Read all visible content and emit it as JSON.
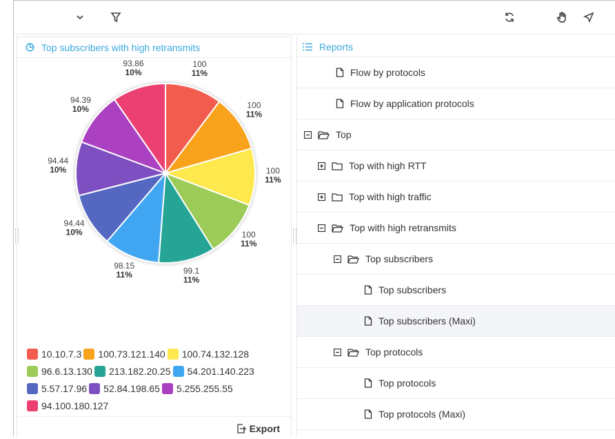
{
  "toolbar": {
    "dropdown_icon": "chevron-down-icon",
    "filter_icon": "filter-icon",
    "refresh_icon": "refresh-icon",
    "hand_icon": "hand-icon",
    "pointer_icon": "cursor-icon"
  },
  "left_panel": {
    "title": "Top subscribers with high retransmits",
    "icon": "pie-chart-icon",
    "export_label": "Export"
  },
  "chart_data": {
    "type": "pie",
    "slices": [
      {
        "label": "10.10.7.3",
        "value": 100,
        "percent": "11%",
        "color": "#f25b50"
      },
      {
        "label": "100.73.121.140",
        "value": 100,
        "percent": "11%",
        "color": "#f9a21d"
      },
      {
        "label": "100.74.132.128",
        "value": 100,
        "percent": "11%",
        "color": "#fde84d"
      },
      {
        "label": "96.6.13.130",
        "value": 100,
        "percent": "11%",
        "color": "#9dcb59"
      },
      {
        "label": "213.182.20.25",
        "value": 99.1,
        "percent": "11%",
        "color": "#26a596"
      },
      {
        "label": "54.201.140.223",
        "value": 98.15,
        "percent": "11%",
        "color": "#3fa6f2"
      },
      {
        "label": "5.57.17.96",
        "value": 94.44,
        "percent": "10%",
        "color": "#5467c1"
      },
      {
        "label": "52.84.198.65",
        "value": 94.44,
        "percent": "10%",
        "color": "#7e4fc0"
      },
      {
        "label": "5.255.255.55",
        "value": 94.39,
        "percent": "10%",
        "color": "#ab3fc1"
      },
      {
        "label": "94.100.180.127",
        "value": 93.86,
        "percent": "10%",
        "color": "#ec3f72"
      }
    ],
    "value_labels": [
      "100",
      "100",
      "100",
      "100",
      "99.1",
      "98.15",
      "94.44",
      "94.44",
      "94.39",
      "93.86"
    ],
    "legend_rows": [
      [
        0,
        1,
        2
      ],
      [
        3,
        4,
        5
      ],
      [
        6,
        7,
        8
      ],
      [
        9
      ]
    ]
  },
  "right_panel": {
    "title": "Reports",
    "icon": "list-icon",
    "items": [
      {
        "label": "Flow by protocols",
        "indent": 1,
        "icon": "file-icon",
        "expander": ""
      },
      {
        "label": "Flow by application protocols",
        "indent": 1,
        "icon": "file-icon",
        "expander": ""
      },
      {
        "label": "Top",
        "indent": 0,
        "icon": "folder-open-icon",
        "expander": "collapse"
      },
      {
        "label": "Top with high RTT",
        "indent": 1,
        "icon": "folder-icon",
        "expander": "expand"
      },
      {
        "label": "Top with high traffic",
        "indent": 1,
        "icon": "folder-icon",
        "expander": "expand"
      },
      {
        "label": "Top with high retransmits",
        "indent": 1,
        "icon": "folder-open-icon",
        "expander": "collapse"
      },
      {
        "label": "Top subscribers",
        "indent": 2,
        "icon": "folder-open-icon",
        "expander": "collapse"
      },
      {
        "label": "Top subscribers",
        "indent": 3,
        "icon": "file-icon",
        "expander": ""
      },
      {
        "label": "Top subscribers (Maxi)",
        "indent": 3,
        "icon": "file-icon",
        "expander": "",
        "selected": true
      },
      {
        "label": "Top protocols",
        "indent": 2,
        "icon": "folder-open-icon",
        "expander": "collapse"
      },
      {
        "label": "Top protocols",
        "indent": 3,
        "icon": "file-icon",
        "expander": ""
      },
      {
        "label": "Top protocols (Maxi)",
        "indent": 3,
        "icon": "file-icon",
        "expander": ""
      }
    ]
  }
}
